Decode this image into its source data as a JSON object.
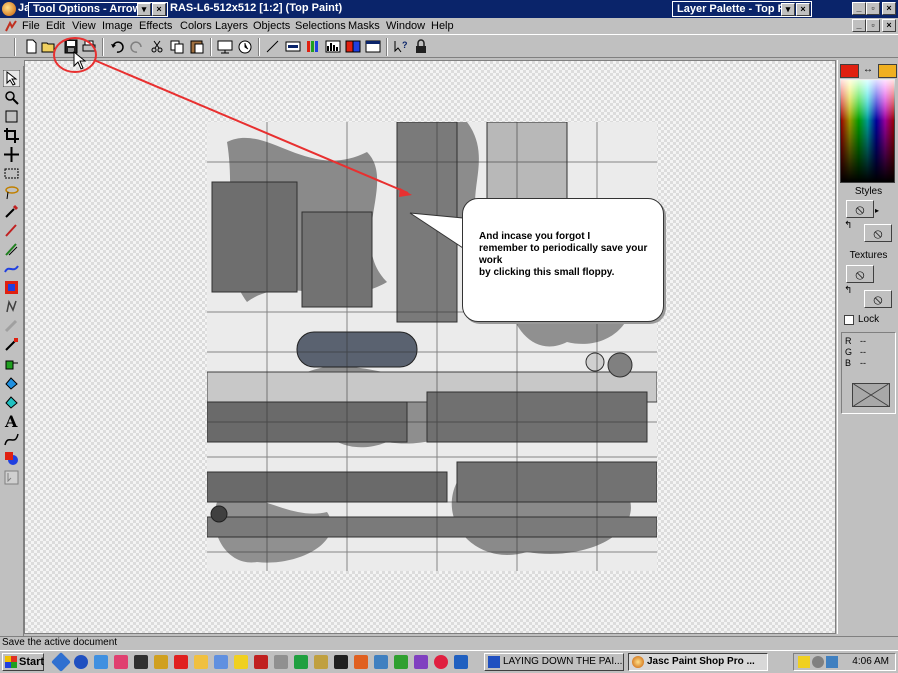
{
  "window": {
    "app_short": "Ja",
    "document_title": "RAS-L6-512x512 [1:2] (Top Paint)",
    "tool_options_title": "Tool Options - Arrow",
    "layer_palette_title": "Layer Palette - Top P"
  },
  "menu": {
    "items": [
      "File",
      "Edit",
      "View",
      "Image",
      "Effects",
      "Colors",
      "Layers",
      "Objects",
      "Selections",
      "Masks",
      "Window",
      "Help"
    ]
  },
  "callout": {
    "lines": [
      "And incase you forgot I",
      "remember to periodically save your",
      "work",
      "by clicking this small floppy."
    ]
  },
  "right_panel": {
    "styles_label": "Styles",
    "textures_label": "Textures",
    "lock_label": "Lock",
    "rgb": [
      {
        "label": "R",
        "value": "--"
      },
      {
        "label": "G",
        "value": "--"
      },
      {
        "label": "B",
        "value": "--"
      }
    ],
    "colors": {
      "foreground": "#e02010",
      "background": "#f0b020"
    }
  },
  "status": {
    "text": "Save the active document"
  },
  "taskbar": {
    "start_label": "Start",
    "tasks": [
      {
        "label": "LAYING DOWN THE PAI...",
        "active": false
      },
      {
        "label": "Jasc Paint Shop Pro ...",
        "active": true
      }
    ],
    "clock": "4:06 AM"
  }
}
